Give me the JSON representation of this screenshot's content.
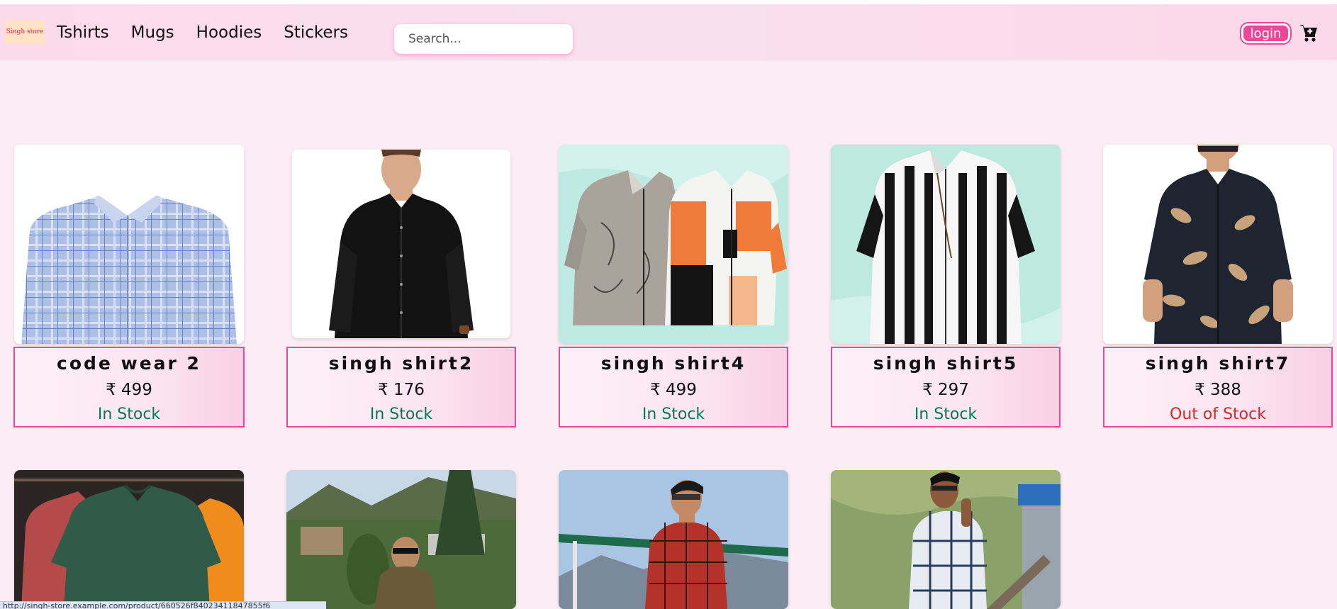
{
  "header": {
    "logo_text": "Singh store",
    "nav": [
      "Tshirts",
      "Mugs",
      "Hoodies",
      "Stickers"
    ],
    "search_placeholder": "Search...",
    "login_label": "login",
    "cart_icon": "cart-icon"
  },
  "products": [
    {
      "name": "code wear 2",
      "price": "₹ 499",
      "stock": "In Stock"
    },
    {
      "name": "singh shirt2",
      "price": "₹ 176",
      "stock": "In Stock"
    },
    {
      "name": "singh shirt4",
      "price": "₹ 499",
      "stock": "In Stock"
    },
    {
      "name": "singh shirt5",
      "price": "₹ 297",
      "stock": "In Stock"
    },
    {
      "name": "singh shirt7",
      "price": "₹ 388",
      "stock": "Out of Stock"
    }
  ],
  "status_url": "http://singh-store.example.com/product/660526f84023411847855f6",
  "colors": {
    "accent": "#ec4899",
    "in_stock": "#047857",
    "out_of_stock": "#dc2626"
  }
}
